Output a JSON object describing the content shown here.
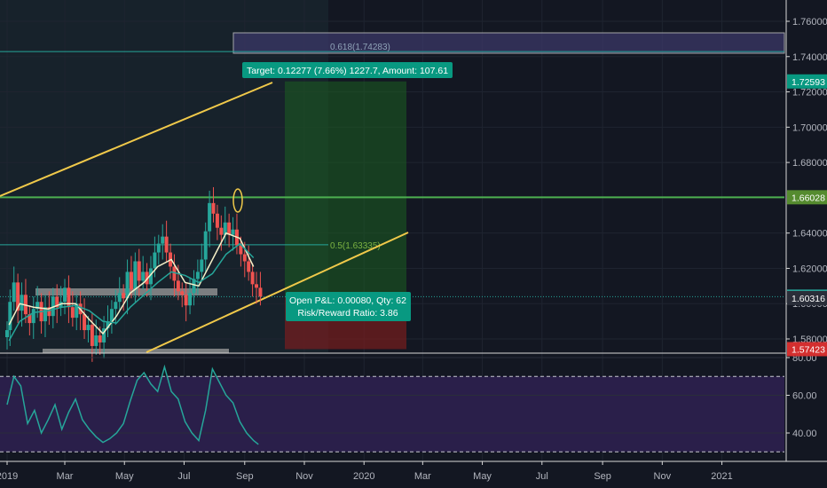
{
  "chart_data": [
    {
      "type": "candlestick",
      "title": "",
      "xlabel": "",
      "ylabel": "",
      "ylim": [
        1.57,
        1.765
      ],
      "y_ticks": [
        1.58,
        1.6,
        1.62,
        1.64,
        1.66,
        1.68,
        1.7,
        1.72,
        1.74,
        1.76
      ],
      "y_tick_labels": [
        "1.58000",
        "1.60000",
        "1.62000",
        "1.64000",
        "",
        "1.68000",
        "1.70000",
        "1.72000",
        "1.74000",
        "1.76000"
      ],
      "x_tick_labels": [
        "2019",
        "Mar",
        "May",
        "Jul",
        "Sep",
        "Nov",
        "2020",
        "Mar",
        "May",
        "Jul",
        "Sep",
        "Nov",
        "2021"
      ],
      "grid": true,
      "colors": {
        "background": "#131722",
        "up": "#26a69a",
        "down": "#ef5350",
        "ma_fast": "#f5f0c8",
        "ma_slow": "#26a69a",
        "channel": "#f0c94a",
        "target_zone": "#1b5e20",
        "stop_zone": "#7f1d1d",
        "hline_green": "#4caf50",
        "fib": "#26a69a",
        "box": "#b39ddb"
      },
      "price_labels": [
        {
          "label": "1.72593",
          "value": 1.72593,
          "color": "#089981"
        },
        {
          "label": "1.66028",
          "value": 1.66028,
          "color": "#558b2f"
        },
        {
          "label": "1.60396",
          "value": 1.60396,
          "color": "#26a69a"
        },
        {
          "label": "1.60316",
          "value": 1.60316,
          "color": "#2a2e39"
        },
        {
          "label": "1.57423",
          "value": 1.57423,
          "color": "#d32f2f"
        }
      ],
      "horizontal_lines": [
        {
          "value": 1.66028,
          "color": "#558b2f"
        },
        {
          "value": 1.60396,
          "color": "#26a69a",
          "dotted": true
        }
      ],
      "fib_levels": [
        {
          "label": "0.618(1.74283)",
          "value": 1.74283
        },
        {
          "label": "0.5(1.63335)",
          "value": 1.63335
        }
      ],
      "annotations": {
        "target": "Target: 0.12277 (7.66%) 1227.7, Amount: 107.61",
        "pnl": "Open P&L: 0.00080, Qty: 62",
        "rr": "Risk/Reward Ratio: 3.86"
      },
      "series": [
        {
          "name": "",
          "x": [
            "2019-01-01",
            "2019-01-04",
            "2019-01-08",
            "2019-01-12",
            "2019-01-16",
            "2019-01-20",
            "2019-01-24",
            "2019-01-28",
            "2019-02-01",
            "2019-02-05",
            "2019-02-09",
            "2019-02-13",
            "2019-02-17",
            "2019-02-21",
            "2019-02-25",
            "2019-03-01",
            "2019-03-05",
            "2019-03-09",
            "2019-03-13",
            "2019-03-17",
            "2019-03-21",
            "2019-03-25",
            "2019-03-29",
            "2019-04-02",
            "2019-04-06",
            "2019-04-10",
            "2019-04-14",
            "2019-04-18",
            "2019-04-22",
            "2019-04-26",
            "2019-04-30",
            "2019-05-04",
            "2019-05-08",
            "2019-05-12",
            "2019-05-16",
            "2019-05-20",
            "2019-05-24",
            "2019-05-28",
            "2019-06-01",
            "2019-06-05",
            "2019-06-09",
            "2019-06-13",
            "2019-06-17",
            "2019-06-21",
            "2019-06-25",
            "2019-06-29",
            "2019-07-03",
            "2019-07-07",
            "2019-07-11",
            "2019-07-15",
            "2019-07-19",
            "2019-07-23",
            "2019-07-27",
            "2019-07-31",
            "2019-08-04",
            "2019-08-08",
            "2019-08-12",
            "2019-08-16",
            "2019-08-20",
            "2019-08-24",
            "2019-08-28",
            "2019-09-01",
            "2019-09-05",
            "2019-09-09",
            "2019-09-13",
            "2019-09-17"
          ],
          "close": [
            1.585,
            1.601,
            1.612,
            1.596,
            1.605,
            1.594,
            1.589,
            1.597,
            1.601,
            1.59,
            1.598,
            1.593,
            1.604,
            1.598,
            1.601,
            1.609,
            1.598,
            1.592,
            1.6,
            1.594,
            1.585,
            1.588,
            1.576,
            1.582,
            1.578,
            1.586,
            1.59,
            1.597,
            1.601,
            1.606,
            1.603,
            1.618,
            1.608,
            1.624,
            1.613,
            1.618,
            1.611,
            1.62,
            1.629,
            1.634,
            1.638,
            1.629,
            1.621,
            1.613,
            1.607,
            1.605,
            1.599,
            1.606,
            1.614,
            1.618,
            1.625,
            1.641,
            1.657,
            1.651,
            1.643,
            1.639,
            1.646,
            1.639,
            1.642,
            1.633,
            1.628,
            1.624,
            1.618,
            1.611,
            1.609,
            1.604
          ]
        },
        {
          "name": "",
          "type": "line",
          "x": [
            "2019-01-03",
            "2019-01-14",
            "2019-01-28",
            "2019-02-12",
            "2019-02-26",
            "2019-03-12",
            "2019-03-26",
            "2019-04-09",
            "2019-04-23",
            "2019-05-07",
            "2019-05-21",
            "2019-06-04",
            "2019-06-18",
            "2019-07-02",
            "2019-07-16",
            "2019-07-30",
            "2019-08-13",
            "2019-08-27",
            "2019-09-10"
          ],
          "values": [
            1.588,
            1.6,
            1.598,
            1.597,
            1.6,
            1.6,
            1.591,
            1.583,
            1.593,
            1.606,
            1.612,
            1.621,
            1.625,
            1.612,
            1.61,
            1.625,
            1.64,
            1.637,
            1.621
          ]
        },
        {
          "name": "",
          "type": "line",
          "x": [
            "2019-01-03",
            "2019-01-14",
            "2019-01-28",
            "2019-02-12",
            "2019-02-26",
            "2019-03-12",
            "2019-03-26",
            "2019-04-09",
            "2019-04-23",
            "2019-05-07",
            "2019-05-21",
            "2019-06-04",
            "2019-06-18",
            "2019-07-02",
            "2019-07-16",
            "2019-07-30",
            "2019-08-13",
            "2019-08-27",
            "2019-09-10"
          ],
          "values": [
            1.579,
            1.59,
            1.595,
            1.596,
            1.598,
            1.599,
            1.596,
            1.59,
            1.589,
            1.598,
            1.605,
            1.612,
            1.618,
            1.616,
            1.612,
            1.617,
            1.628,
            1.634,
            1.626
          ]
        }
      ]
    },
    {
      "type": "line",
      "title": "",
      "xlabel": "",
      "ylabel": "",
      "ylim": [
        25,
        82
      ],
      "y_tick_labels": [
        "80.00",
        "60.00",
        "40.00"
      ],
      "y_ticks": [
        80,
        60,
        40
      ],
      "bands": [
        70,
        30
      ],
      "grid": true,
      "colors": {
        "line": "#26a69a",
        "band_fill": "#2a1f4a",
        "band_line": "#c8c8d0"
      },
      "series": [
        {
          "name": "",
          "x": [
            "2019-01-01",
            "2019-01-08",
            "2019-01-15",
            "2019-01-22",
            "2019-01-29",
            "2019-02-05",
            "2019-02-12",
            "2019-02-19",
            "2019-02-26",
            "2019-03-05",
            "2019-03-12",
            "2019-03-19",
            "2019-03-26",
            "2019-04-02",
            "2019-04-09",
            "2019-04-16",
            "2019-04-23",
            "2019-04-30",
            "2019-05-07",
            "2019-05-14",
            "2019-05-21",
            "2019-05-28",
            "2019-06-04",
            "2019-06-11",
            "2019-06-18",
            "2019-06-25",
            "2019-07-02",
            "2019-07-09",
            "2019-07-16",
            "2019-07-23",
            "2019-07-30",
            "2019-08-06",
            "2019-08-13",
            "2019-08-20",
            "2019-08-27",
            "2019-09-03",
            "2019-09-10",
            "2019-09-15"
          ],
          "values": [
            55,
            70,
            65,
            45,
            52,
            40,
            47,
            55,
            42,
            51,
            58,
            47,
            42,
            38,
            35,
            37,
            40,
            45,
            57,
            68,
            72,
            66,
            62,
            75,
            62,
            58,
            46,
            40,
            36,
            52,
            74,
            67,
            60,
            56,
            46,
            40,
            36,
            34
          ]
        }
      ]
    }
  ]
}
